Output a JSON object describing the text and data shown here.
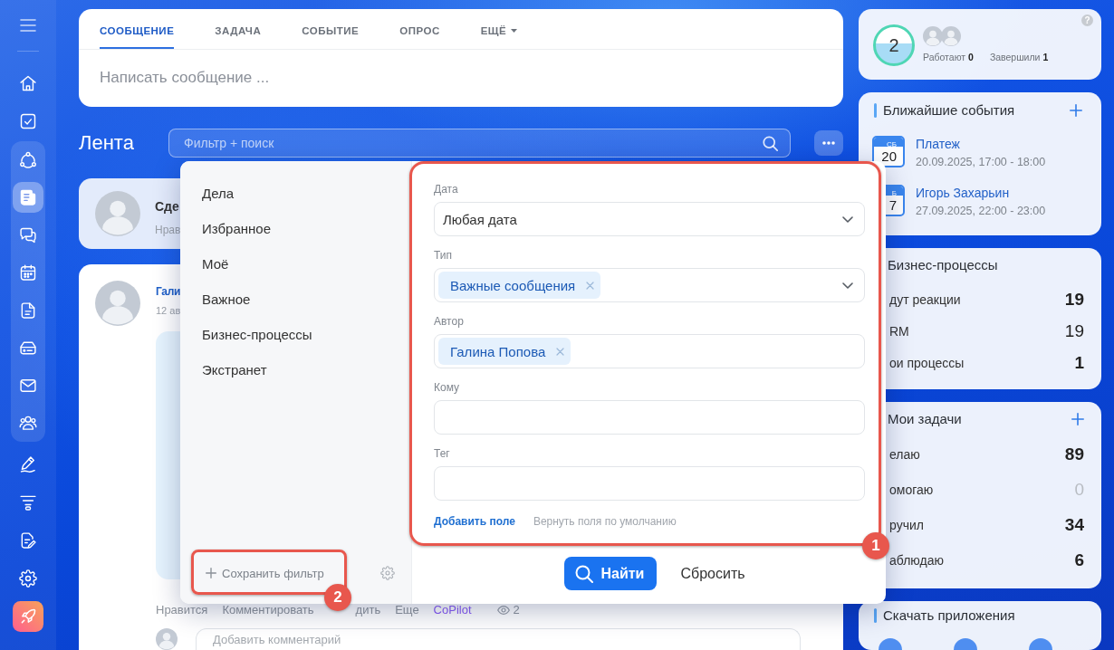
{
  "sidebar": {
    "top": [
      {
        "kind": "home",
        "selected": false
      },
      {
        "kind": "tasks",
        "selected": false
      }
    ],
    "group": [
      {
        "kind": "crm",
        "selected": false
      },
      {
        "kind": "feed",
        "selected": true
      },
      {
        "kind": "chat",
        "selected": false
      },
      {
        "kind": "calendar",
        "selected": false
      },
      {
        "kind": "document",
        "selected": false
      },
      {
        "kind": "drive",
        "selected": false
      },
      {
        "kind": "mail",
        "selected": false
      },
      {
        "kind": "people",
        "selected": false
      }
    ],
    "bottom": [
      {
        "kind": "signature",
        "selected": false
      },
      {
        "kind": "filter",
        "selected": false
      },
      {
        "kind": "doc-edit",
        "selected": false
      },
      {
        "kind": "settings",
        "selected": false
      },
      {
        "kind": "rocket"
      }
    ]
  },
  "composer": {
    "tabs": [
      {
        "label": "СООБЩЕНИЕ",
        "selected": true,
        "kind": "tab"
      },
      {
        "label": "ЗАДАЧА",
        "selected": false,
        "kind": "tab"
      },
      {
        "label": "СОБЫТИЕ",
        "selected": false,
        "kind": "tab"
      },
      {
        "label": "ОПРОС",
        "selected": false,
        "kind": "tab"
      },
      {
        "label": "ЕЩЁ",
        "selected": false,
        "kind": "dropdown"
      }
    ],
    "placeholder": "Написать сообщение ..."
  },
  "feed": {
    "title": "Лента",
    "search": {
      "placeholder": "Фильтр + поиск"
    },
    "pinned": {
      "title": "Сде",
      "subtitle": "Нрав"
    },
    "post": {
      "author": "Гали",
      "date": "12 ав",
      "actions": [
        {
          "label": "Нравится",
          "kind": "action"
        },
        {
          "label": "Комментировать",
          "kind": "action"
        },
        {
          "label": "дить",
          "kind": "action"
        },
        {
          "label": "Еще",
          "kind": "action"
        },
        {
          "label": "CoPilot",
          "kind": "copilot"
        }
      ],
      "views": "2",
      "comment": {
        "placeholder": "Добавить комментарий"
      }
    }
  },
  "filter_popup": {
    "presets": [
      {
        "label": "Дела",
        "selected": false
      },
      {
        "label": "Избранное",
        "selected": false
      },
      {
        "label": "Моё",
        "selected": false
      },
      {
        "label": "Важное",
        "selected": false
      },
      {
        "label": "Бизнес-процессы",
        "selected": false
      },
      {
        "label": "Экстранет",
        "selected": false
      }
    ],
    "save_button": "Сохранить фильтр",
    "fields": [
      {
        "label": "Дата",
        "kind": "select",
        "value": "Любая дата"
      },
      {
        "label": "Тип",
        "kind": "select",
        "tags": [
          "Важные сообщения"
        ]
      },
      {
        "label": "Автор",
        "kind": "entity",
        "tags": [
          "Галина Попова"
        ]
      },
      {
        "label": "Кому",
        "kind": "entity"
      },
      {
        "label": "Тег",
        "kind": "text"
      }
    ],
    "add_field": "Добавить поле",
    "restore_fields": "Вернуть поля по умолчанию",
    "find_button": "Найти",
    "reset_button": "Сбросить"
  },
  "annotations": [
    {
      "number": "1",
      "kind": "fields"
    },
    {
      "number": "2",
      "kind": "save"
    }
  ],
  "widgets": [
    {
      "kind": "workday",
      "count": "2",
      "stats": [
        "Работают **0**",
        "Завершили **1**"
      ],
      "help": "?"
    },
    {
      "kind": "events",
      "title": "Ближайшие события",
      "add": true,
      "items": [
        {
          "weekday": "СБ",
          "day": "20",
          "name": "Платеж",
          "time": "20.09.2025, 17:00 - 18:00"
        },
        {
          "weekday": "Б",
          "day": "7",
          "name": "Игорь Захарьин",
          "time": "27.09.2025, 22:00 - 23:00"
        }
      ]
    },
    {
      "kind": "counters",
      "title": "Бизнес-процессы",
      "add": false,
      "rows": [
        {
          "label": "дут реакции",
          "value": "19",
          "kind": "strong"
        },
        {
          "label": "RM",
          "value": "19",
          "kind": "plain"
        },
        {
          "label": "ои процессы",
          "value": "1",
          "kind": "strong"
        }
      ]
    },
    {
      "kind": "counters",
      "title": "Мои задачи",
      "add": true,
      "rows": [
        {
          "label": "елаю",
          "value": "89",
          "kind": "strong"
        },
        {
          "label": "омогаю",
          "value": "0",
          "kind": "muted"
        },
        {
          "label": "ручил",
          "value": "34",
          "kind": "strong"
        },
        {
          "label": "аблюдаю",
          "value": "6",
          "kind": "strong"
        }
      ]
    },
    {
      "kind": "apps",
      "title": "Скачать приложения"
    }
  ]
}
